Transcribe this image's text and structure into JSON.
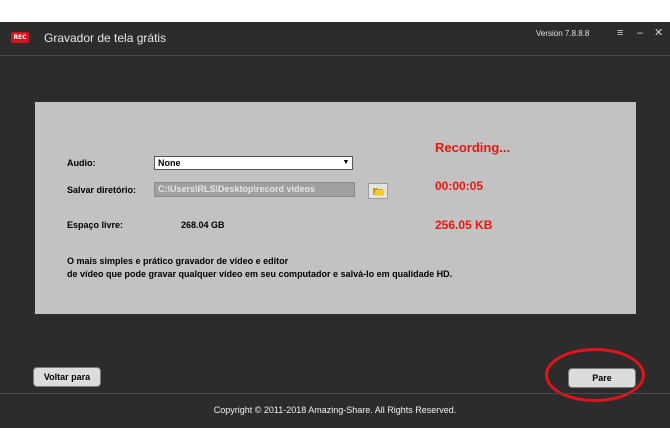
{
  "window": {
    "title": "Gravador de tela grátis",
    "logo_text": "REC",
    "version": "Version 7.8.8.8",
    "controls": {
      "settings": "≡",
      "minimize": "–",
      "close": "✕"
    }
  },
  "form": {
    "audio_label": "Audio:",
    "audio_value": "None",
    "save_dir_label": "Salvar diretório:",
    "save_dir_value": "C:\\Users\\RLS\\Desktop\\record videos",
    "free_space_label": "Espaço livre:",
    "free_space_value": "268.04 GB",
    "description_line1": "O mais simples e prático gravador de vídeo e editor",
    "description_line2": "de vídeo que pode gravar qualquer vídeo em seu computador e salvá-lo em qualidade HD."
  },
  "status": {
    "state": "Recording...",
    "elapsed": "00:00:05",
    "file_size": "256.05 KB",
    "accent_color": "#e8170d"
  },
  "buttons": {
    "back": "Voltar para",
    "stop": "Pare"
  },
  "footer": {
    "copyright": "Copyright © 2011-2018 Amazing-Share. All Rights Reserved."
  },
  "icons": [
    "rec-logo-icon",
    "folder-open-icon",
    "dropdown-arrow-icon"
  ]
}
